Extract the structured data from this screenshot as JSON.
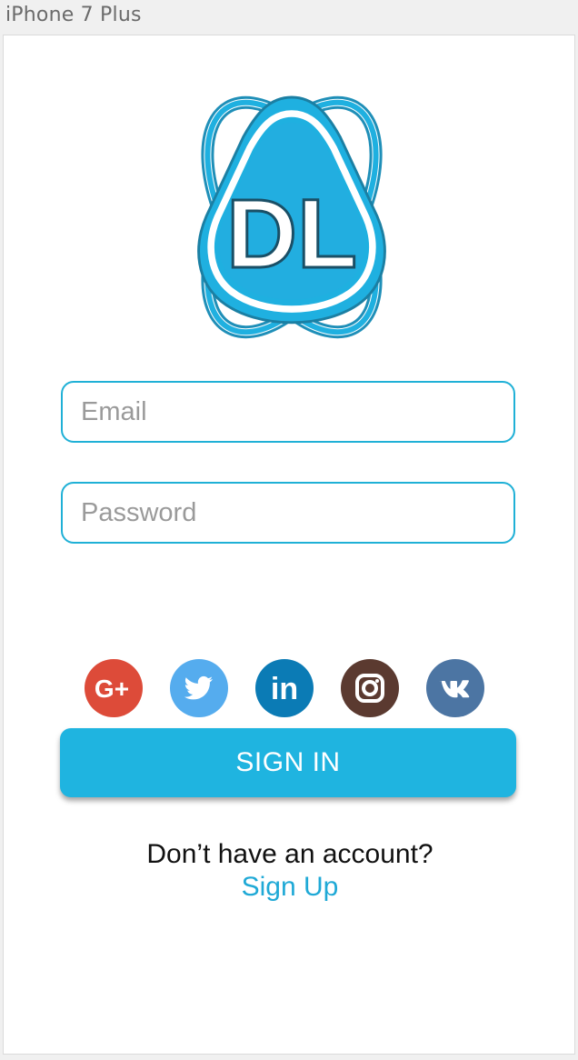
{
  "device_label": "iPhone 7 Plus",
  "logo": {
    "text": "DL",
    "color": "#1fb0e0"
  },
  "form": {
    "email_placeholder": "Email",
    "password_placeholder": "Password"
  },
  "socials": [
    {
      "name": "google-plus",
      "label": "G+",
      "color": "#dd4b39"
    },
    {
      "name": "twitter",
      "color": "#55acee"
    },
    {
      "name": "linkedin",
      "label": "in",
      "color": "#0b7bb5"
    },
    {
      "name": "instagram",
      "color": "#5b3a30"
    },
    {
      "name": "vk",
      "label": "VK",
      "color": "#4c75a3"
    }
  ],
  "signin_label": "SIGN IN",
  "account_prompt": "Don’t have an account?",
  "signup_label": "Sign Up"
}
